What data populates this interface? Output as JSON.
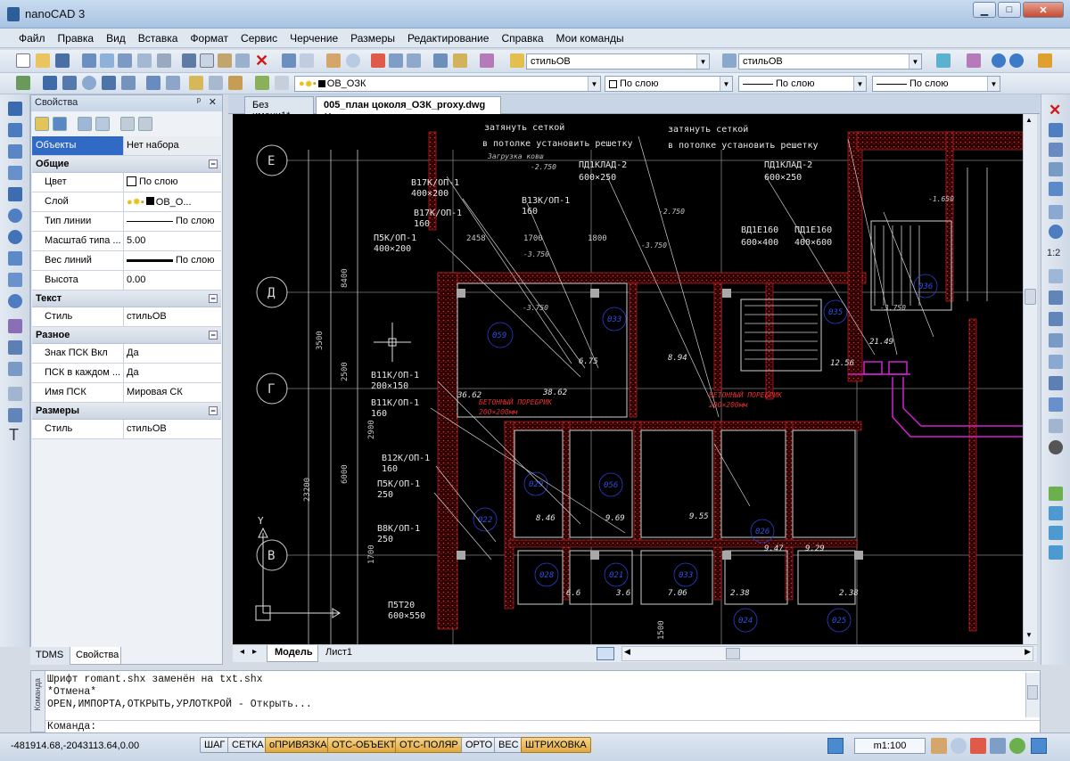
{
  "window": {
    "title": "nanoCAD 3",
    "minimize": "▁",
    "maximize": "□",
    "close": "✕"
  },
  "menu": [
    "Файл",
    "Правка",
    "Вид",
    "Вставка",
    "Формат",
    "Сервис",
    "Черчение",
    "Размеры",
    "Редактирование",
    "Справка",
    "Мои команды"
  ],
  "toolbar": {
    "text_style": "стильОВ",
    "dim_style": "стильОВ",
    "layer": "ОВ_ОЗК",
    "color": "По слою",
    "linetype": "По слою",
    "lineweight": "По слою"
  },
  "properties": {
    "title": "Свойства",
    "pin": "ᵖ",
    "close": "✕",
    "selection_label": "Объекты",
    "selection_value": "Нет набора",
    "sections": [
      {
        "name": "Общие",
        "rows": [
          {
            "k": "Цвет",
            "v": "По слою"
          },
          {
            "k": "Слой",
            "v": "ОВ_О..."
          },
          {
            "k": "Тип линии",
            "v": "По слою"
          },
          {
            "k": "Масштаб типа ...",
            "v": "5.00"
          },
          {
            "k": "Вес линий",
            "v": "По слою"
          },
          {
            "k": "Высота",
            "v": "0.00"
          }
        ]
      },
      {
        "name": "Текст",
        "rows": [
          {
            "k": "Стиль",
            "v": "стильОВ"
          }
        ]
      },
      {
        "name": "Разное",
        "rows": [
          {
            "k": "Знак ПСК Вкл",
            "v": "Да"
          },
          {
            "k": "ПСК в каждом ...",
            "v": "Да"
          },
          {
            "k": "Имя ПСК",
            "v": "Мировая СК"
          }
        ]
      },
      {
        "name": "Размеры",
        "rows": [
          {
            "k": "Стиль",
            "v": "стильОВ"
          }
        ]
      }
    ],
    "tabs": [
      "TDMS",
      "Свойства"
    ]
  },
  "doc_tabs": [
    {
      "label": "Без имени1*"
    },
    {
      "label": "005_план цоколя_ОЗК_proxy.dwg",
      "close": "✕"
    }
  ],
  "layout_tabs": [
    "Модель",
    "Лист1"
  ],
  "command": {
    "side_label": "Команда",
    "lines": [
      "Шрифт romant.shx заменён на txt.shx",
      "*Отмена*",
      "OPEN,ИМПОРТА,ОТКРЫТЬ,УРЛОТКРОЙ - Открыть..."
    ],
    "prompt": "Команда:"
  },
  "status": {
    "coords": "-481914.68,-2043113.64,0.00",
    "toggles": [
      {
        "label": "ШАГ",
        "on": false
      },
      {
        "label": "СЕТКА",
        "on": false
      },
      {
        "label": "оПРИВЯЗКА",
        "on": true
      },
      {
        "label": "ОТС-ОБЪЕКТ",
        "on": true
      },
      {
        "label": "ОТС-ПОЛЯР",
        "on": true
      },
      {
        "label": "ОРТО",
        "on": false
      },
      {
        "label": "ВЕС",
        "on": false
      },
      {
        "label": "ШТРИХОВКА",
        "on": true
      }
    ],
    "scale": "m1:100"
  },
  "drawing": {
    "axes": [
      "Е",
      "Д",
      "Г",
      "В"
    ],
    "ucs_y": "Y",
    "dims_v": [
      "8400",
      "3500",
      "2500",
      "6000",
      "2900",
      "23200",
      "1700",
      "1500"
    ],
    "dims_h": [
      "2458",
      "1700",
      "1800"
    ],
    "notes": [
      "затянуть сеткой",
      "в потолке установить решетку",
      "затянуть сеткой",
      "в потолке установить решетку",
      "Загрузка ковш"
    ],
    "labels": [
      "В17К/ОП-1",
      "400×200",
      "В17К/ОП-1",
      "160",
      "П5К/ОП-1",
      "400×200",
      "В13К/ОП-1",
      "160",
      "ПД1КЛАД-2",
      "600×250",
      "ПД1КЛАД-2",
      "600×250",
      "ВД1Е160",
      "600×400",
      "ПД1Е160",
      "400×600",
      "В11К/ОП-1",
      "200×150",
      "В11К/ОП-1",
      "160",
      "В12К/ОП-1",
      "160",
      "П5К/ОП-1",
      "250",
      "В8К/ОП-1",
      "250",
      "П5Т20",
      "600×550"
    ],
    "red_notes": [
      "БЕТОННЫЙ ПОРЕБРИК",
      "200×200мм",
      "БЕТОННЫЙ ПОРЕБРИК",
      "200×200мм"
    ],
    "levels": [
      "-3.750",
      "-3.750",
      "-3.750",
      "-1.650",
      "-3.750",
      "-2.750",
      "-2.750"
    ],
    "room_nums": [
      "059",
      "033",
      "035",
      "036",
      "029",
      "056",
      "022",
      "028",
      "021",
      "024",
      "026",
      "025",
      "033"
    ],
    "areas": [
      "6.75",
      "8.94",
      "12.56",
      "21.49",
      "38.62",
      "8.46",
      "9.69",
      "9.55",
      "9.47",
      "9.29",
      "6.6",
      "3.6",
      "7.06",
      "2.38",
      "2.38",
      "36.62"
    ]
  }
}
